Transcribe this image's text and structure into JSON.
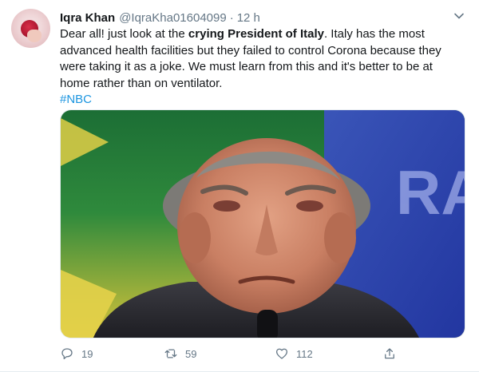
{
  "tweet": {
    "author_name": "Iqra Khan",
    "author_handle": "@IqraKha01604099",
    "separator": "·",
    "time": "12 h",
    "text": {
      "part1": "Dear all! just look at the ",
      "bold": "crying President of Italy",
      "part2": ". Italy has the most advanced health facilities but they failed to control Corona because they were taking it as a joke. We must learn from this and it's better to be at home rather than on ventilator.",
      "hashtag": "#NBC"
    },
    "media": {
      "background_text": "RA"
    },
    "actions": {
      "replies": "19",
      "retweets": "59",
      "likes": "112"
    }
  },
  "colors": {
    "accent": "#1b95e0",
    "secondary_text": "#657786",
    "primary_text": "#14171a"
  },
  "icons": [
    "chevron-down-icon",
    "reply-icon",
    "retweet-icon",
    "like-icon",
    "share-icon"
  ]
}
